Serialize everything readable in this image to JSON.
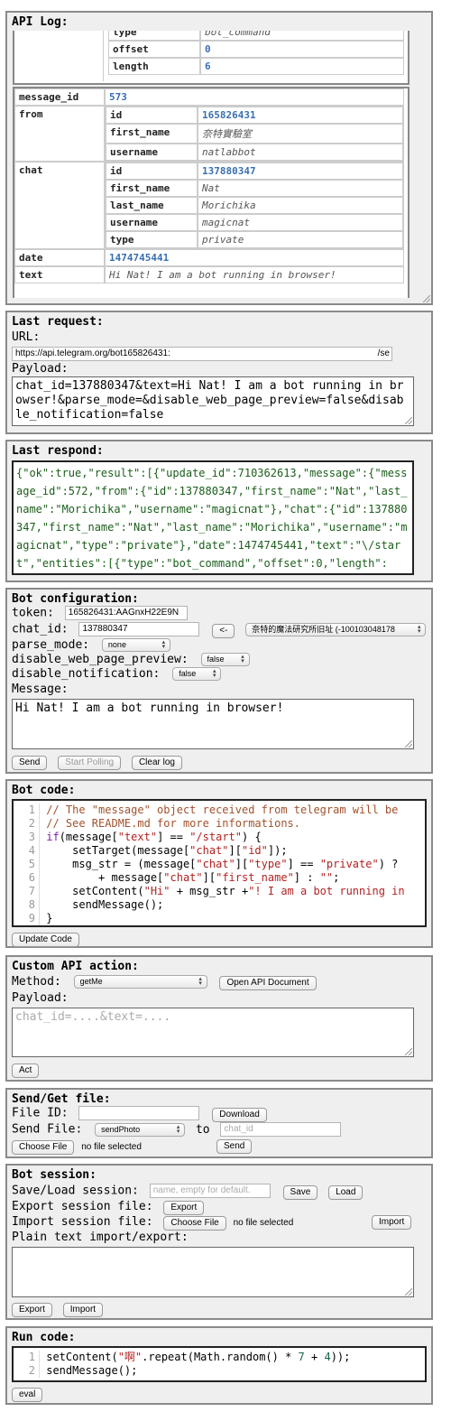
{
  "api_log": {
    "title": "API Log:",
    "entity_rows": [
      {
        "key": "type",
        "value": "bot_command",
        "kind": "str"
      },
      {
        "key": "offset",
        "value": "0",
        "kind": "num"
      },
      {
        "key": "length",
        "value": "6",
        "kind": "num"
      }
    ],
    "message_id": {
      "key": "message_id",
      "value": "573"
    },
    "from": {
      "key": "from",
      "rows": [
        {
          "key": "id",
          "value": "165826431",
          "kind": "num"
        },
        {
          "key": "first_name",
          "value": "奈特實驗室",
          "kind": "str"
        },
        {
          "key": "username",
          "value": "natlabbot",
          "kind": "str"
        }
      ]
    },
    "chat": {
      "key": "chat",
      "rows": [
        {
          "key": "id",
          "value": "137880347",
          "kind": "num"
        },
        {
          "key": "first_name",
          "value": "Nat",
          "kind": "str"
        },
        {
          "key": "last_name",
          "value": "Morichika",
          "kind": "str"
        },
        {
          "key": "username",
          "value": "magicnat",
          "kind": "str"
        },
        {
          "key": "type",
          "value": "private",
          "kind": "str"
        }
      ]
    },
    "date": {
      "key": "date",
      "value": "1474745441"
    },
    "text": {
      "key": "text",
      "value": "Hi Nat! I am a bot running in browser!"
    }
  },
  "last_request": {
    "title": "Last request:",
    "url_label": "URL:",
    "url_value": "https://api.telegram.org/bot165826431:",
    "url_suffix": "/se",
    "payload_label": "Payload:",
    "payload_value": "chat_id=137880347&text=Hi Nat! I am a bot running in browser!&parse_mode=&disable_web_page_preview=false&disable_notification=false"
  },
  "last_respond": {
    "title": "Last respond:",
    "body": "{\"ok\":true,\"result\":[{\"update_id\":710362613,\"message\":{\"message_id\":572,\"from\":{\"id\":137880347,\"first_name\":\"Nat\",\"last_name\":\"Morichika\",\"username\":\"magicnat\"},\"chat\":{\"id\":137880347,\"first_name\":\"Nat\",\"last_name\":\"Morichika\",\"username\":\"magicnat\",\"type\":\"private\"},\"date\":1474745441,\"text\":\"\\/start\",\"entities\":[{\"type\":\"bot_command\",\"offset\":0,\"length\":6}]}}]}"
  },
  "bot_config": {
    "title": "Bot configuration:",
    "token_label": "token:",
    "token_value": "165826431:AAGnxH22E9N",
    "chat_id_label": "chat_id:",
    "chat_id_value": "137880347",
    "arrow_label": "<-",
    "chat_select": "奈特的魔法研究所旧址 (-100103048178",
    "parse_mode_label": "parse_mode:",
    "parse_mode_value": "none",
    "preview_label": "disable_web_page_preview:",
    "preview_value": "false",
    "notification_label": "disable_notification:",
    "notification_value": "false",
    "message_label": "Message:",
    "message_value": "Hi Nat! I am a bot running in browser!",
    "send_label": "Send",
    "polling_label": "Start Polling",
    "clear_label": "Clear log"
  },
  "bot_code": {
    "title": "Bot code:",
    "update_label": "Update Code",
    "line_numbers": [
      "1",
      "2",
      "3",
      "4",
      "5",
      "6",
      "7",
      "8",
      "9"
    ]
  },
  "custom_api": {
    "title": "Custom API action:",
    "method_label": "Method:",
    "method_value": "getMe",
    "open_doc_label": "Open API Document",
    "payload_label": "Payload:",
    "payload_placeholder": "chat_id=....&text=....",
    "act_label": "Act"
  },
  "send_file": {
    "title": "Send/Get file:",
    "file_id_label": "File ID:",
    "download_label": "Download",
    "send_file_label": "Send File:",
    "send_method": "sendPhoto",
    "to_label": "to",
    "chat_id_placeholder": "chat_id",
    "choose_label": "Choose File",
    "no_file": "no file selected",
    "send_label": "Send"
  },
  "bot_session": {
    "title": "Bot session:",
    "save_load_label": "Save/Load session:",
    "name_placeholder": "name, empty for default.",
    "save_label": "Save",
    "load_label": "Load",
    "export_file_label": "Export session file:",
    "export_btn": "Export",
    "import_file_label": "Import session file:",
    "choose_label": "Choose File",
    "no_file": "no file selected",
    "import_btn": "Import",
    "plain_label": "Plain text import/export:",
    "export_label": "Export",
    "import_label": "Import"
  },
  "run_code": {
    "title": "Run code:",
    "line_numbers": [
      "1",
      "2"
    ],
    "eval_label": "eval"
  }
}
